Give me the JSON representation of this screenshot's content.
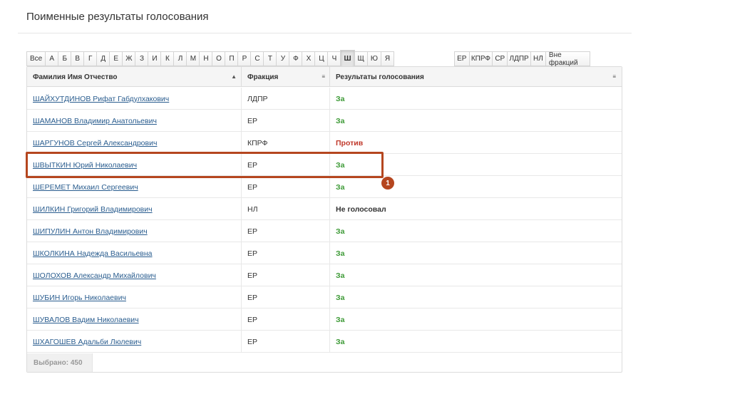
{
  "page": {
    "title": "Поименные результаты голосования"
  },
  "letters": [
    "Все",
    "А",
    "Б",
    "В",
    "Г",
    "Д",
    "Е",
    "Ж",
    "З",
    "И",
    "К",
    "Л",
    "М",
    "Н",
    "О",
    "П",
    "Р",
    "С",
    "Т",
    "У",
    "Ф",
    "Х",
    "Ц",
    "Ч",
    "Ш",
    "Щ",
    "Ю",
    "Я"
  ],
  "active_letter": "Ш",
  "factions": [
    "ЕР",
    "КПРФ",
    "СР",
    "ЛДПР",
    "НЛ",
    "Вне фракций"
  ],
  "table": {
    "headers": {
      "name": "Фамилия Имя Отчество",
      "faction": "Фракция",
      "result": "Результаты голосования"
    },
    "rows": [
      {
        "name": "ШАЙХУТДИНОВ Рифат Габдулхакович",
        "faction": "ЛДПР",
        "result": "За"
      },
      {
        "name": "ШАМАНОВ Владимир Анатольевич",
        "faction": "ЕР",
        "result": "За"
      },
      {
        "name": "ШАРГУНОВ Сергей Александрович",
        "faction": "КПРФ",
        "result": "Против"
      },
      {
        "name": "ШВЫТКИН Юрий Николаевич",
        "faction": "ЕР",
        "result": "За"
      },
      {
        "name": "ШЕРЕМЕТ Михаил Сергеевич",
        "faction": "ЕР",
        "result": "За"
      },
      {
        "name": "ШИЛКИН Григорий Владимирович",
        "faction": "НЛ",
        "result": "Не голосовал"
      },
      {
        "name": "ШИПУЛИН Антон Владимирович",
        "faction": "ЕР",
        "result": "За"
      },
      {
        "name": "ШКОЛКИНА Надежда Васильевна",
        "faction": "ЕР",
        "result": "За"
      },
      {
        "name": "ШОЛОХОВ Александр Михайлович",
        "faction": "ЕР",
        "result": "За"
      },
      {
        "name": "ШУБИН Игорь Николаевич",
        "faction": "ЕР",
        "result": "За"
      },
      {
        "name": "ШУВАЛОВ Вадим Николаевич",
        "faction": "ЕР",
        "result": "За"
      },
      {
        "name": "ШХАГОШЕВ Адальби Люлевич",
        "faction": "ЕР",
        "result": "За"
      }
    ]
  },
  "footer": {
    "selected": "Выбрано: 450"
  },
  "annotation": {
    "badge": "1"
  },
  "colors": {
    "vote_za": "#3d9a36",
    "vote_protiv": "#c0392b",
    "highlight": "#b5461f",
    "link": "#2a5d8f"
  }
}
